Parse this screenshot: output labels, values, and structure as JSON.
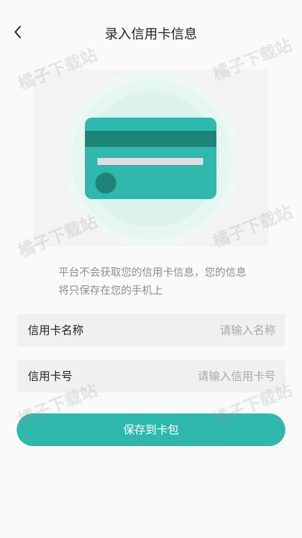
{
  "header": {
    "title": "录入信用卡信息"
  },
  "notice": "平台不会获取您的信用卡信息，您的信息将只保存在您的手机上",
  "form": {
    "name_field": {
      "label": "信用卡名称",
      "placeholder": "请输入名称"
    },
    "number_field": {
      "label": "信用卡号",
      "placeholder": "请输入信用卡号"
    }
  },
  "actions": {
    "save_label": "保存到卡包"
  },
  "watermark": "橘子下载站",
  "colors": {
    "accent": "#2fb8ac",
    "card_stripe": "#1e8478",
    "card_chip": "#1e8478",
    "background": "#fafafa",
    "field_background": "#f0f0f0"
  },
  "icons": {
    "back": "chevron-left-icon",
    "illustration": "credit-card-icon"
  }
}
